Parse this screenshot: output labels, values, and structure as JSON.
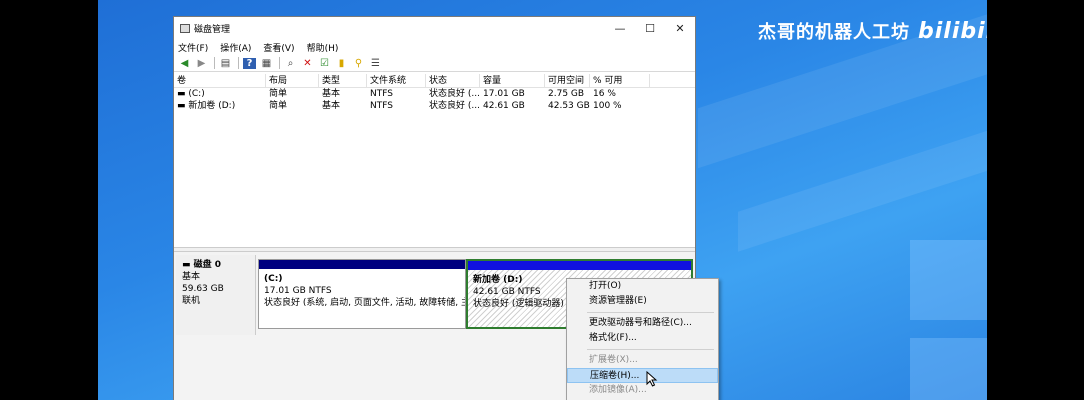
{
  "watermark": {
    "text": "杰哥的机器人工坊",
    "logo": "bilibili"
  },
  "window": {
    "title": "磁盘管理",
    "controls": {
      "minimize": "—",
      "maximize": "☐",
      "close": "✕"
    }
  },
  "menubar": [
    "文件(F)",
    "操作(A)",
    "查看(V)",
    "帮助(H)"
  ],
  "toolbar": [
    "back-icon",
    "forward-icon",
    "sep",
    "properties-icon",
    "sep",
    "help-icon",
    "view-icon",
    "sep",
    "connect-icon",
    "delete-icon",
    "check-icon",
    "new-icon",
    "search-icon",
    "list-icon"
  ],
  "volume_list": {
    "columns": [
      "卷",
      "布局",
      "类型",
      "文件系统",
      "状态",
      "容量",
      "可用空间",
      "% 可用"
    ],
    "rows": [
      [
        "(C:)",
        "简单",
        "基本",
        "NTFS",
        "状态良好 (...",
        "17.01 GB",
        "2.75 GB",
        "16 %"
      ],
      [
        "新加卷 (D:)",
        "简单",
        "基本",
        "NTFS",
        "状态良好 (...",
        "42.61 GB",
        "42.53 GB",
        "100 %"
      ]
    ]
  },
  "disk": {
    "name": "磁盘 0",
    "type": "基本",
    "size": "59.63 GB",
    "status": "联机",
    "partitions": [
      {
        "name": "(C:)",
        "size": "17.01 GB NTFS",
        "status": "状态良好 (系统, 启动, 页面文件, 活动, 故障转储, 主分",
        "bar_color": "#000080"
      },
      {
        "name": "新加卷  (D:)",
        "size": "42.61 GB NTFS",
        "status": "状态良好 (逻辑驱动器)",
        "bar_color": "#1010e0"
      }
    ]
  },
  "context_menu": {
    "items": [
      {
        "label": "打开(O)",
        "state": "normal"
      },
      {
        "label": "资源管理器(E)",
        "state": "normal"
      },
      {
        "label": "sep"
      },
      {
        "label": "更改驱动器号和路径(C)...",
        "state": "normal"
      },
      {
        "label": "格式化(F)...",
        "state": "normal"
      },
      {
        "label": "sep"
      },
      {
        "label": "扩展卷(X)...",
        "state": "disabled"
      },
      {
        "label": "压缩卷(H)...",
        "state": "highlighted"
      },
      {
        "label": "添加镜像(A)...",
        "state": "disabled"
      }
    ]
  },
  "colors": {
    "desktop": "#2a86e6",
    "c_bar": "#000080",
    "d_bar": "#1010e0",
    "d_border": "#2f7d2f",
    "highlight": "#bcdcf8"
  }
}
